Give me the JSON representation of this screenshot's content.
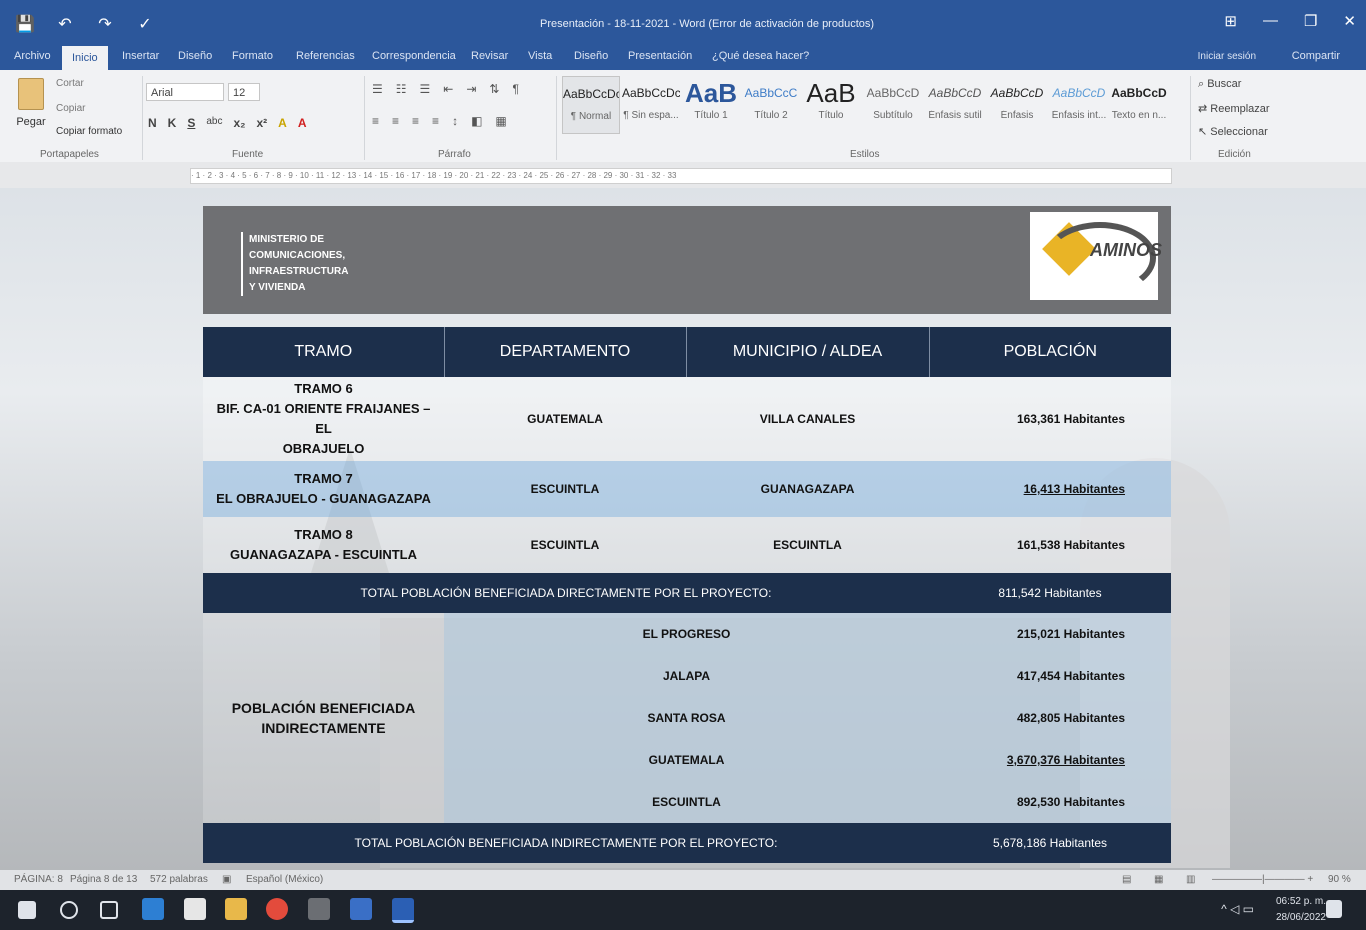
{
  "window": {
    "title": "Presentación - 18-11-2021 - Word (Error de activación de productos)",
    "controls": [
      "⊞",
      "—",
      "❐",
      "✕"
    ]
  },
  "quick_access": [
    "💾",
    "↶",
    "↷",
    "✓"
  ],
  "tabs": [
    "Archivo",
    "Inicio",
    "Insertar",
    "Diseño",
    "Formato",
    "Referencias",
    "Correspondencia",
    "Revisar",
    "Vista",
    "Diseño",
    "Presentación",
    "¿Qué desea hacer?"
  ],
  "account": {
    "signin": "Iniciar sesión",
    "share": "Compartir"
  },
  "ribbon": {
    "clipboard": {
      "paste": "Pegar",
      "cut": "Cortar",
      "copy": "Copiar",
      "format_painter": "Copiar formato",
      "label": "Portapapeles"
    },
    "font": {
      "name": "Arial",
      "size": "12",
      "label": "Fuente",
      "buttons": [
        "N",
        "K",
        "S",
        "abc",
        "x₂",
        "x²",
        "A",
        "A"
      ]
    },
    "paragraph": {
      "label": "Párrafo"
    },
    "styles": {
      "label": "Estilos",
      "items": [
        {
          "sample": "AaBbCcDc",
          "name": "¶ Normal"
        },
        {
          "sample": "AaBbCcDc",
          "name": "¶ Sin espa..."
        },
        {
          "sample": "AaB",
          "name": "Título 1"
        },
        {
          "sample": "AaBbCcC",
          "name": "Título 2"
        },
        {
          "sample": "AaB",
          "name": "Título"
        },
        {
          "sample": "AaBbCcD",
          "name": "Subtítulo"
        },
        {
          "sample": "AaBbCcD",
          "name": "Énfasis sutil"
        },
        {
          "sample": "AaBbCcD",
          "name": "Énfasis"
        },
        {
          "sample": "AaBbCcD",
          "name": "Énfasis int..."
        },
        {
          "sample": "AaBbCcD",
          "name": "Texto en n..."
        }
      ]
    },
    "editing": {
      "label": "Edición",
      "find": "Buscar",
      "replace": "Reemplazar",
      "select": "Seleccionar"
    }
  },
  "ruler": "· 1 · 2 · 3 · 4 · 5 · 6 · 7 · 8 · 9 · 10 · 11 · 12 · 13 · 14 · 15 · 16 · 17 · 18 · 19 · 20 · 21 · 22 · 23 · 24 · 25 · 26 · 27 · 28 · 29 · 30 · 31 · 32 · 33",
  "document": {
    "header": {
      "ministry_lines": [
        "MINISTERIO DE",
        "COMUNICACIONES,",
        "INFRAESTRUCTURA",
        "Y VIVIENDA"
      ],
      "logo_text": "AMINOS"
    },
    "table": {
      "headers": [
        "TRAMO",
        "DEPARTAMENTO",
        "MUNICIPIO / ALDEA",
        "POBLACIÓN"
      ],
      "rows": [
        {
          "tramo_lines": [
            "TRAMO 6",
            "BIF. CA-01 ORIENTE FRAIJANES – EL",
            "OBRAJUELO"
          ],
          "departamento": "GUATEMALA",
          "municipio": "VILLA CANALES",
          "poblacion": "163,361 Habitantes"
        },
        {
          "tramo_lines": [
            "TRAMO 7",
            "EL OBRAJUELO - GUANAGAZAPA"
          ],
          "departamento": "ESCUINTLA",
          "municipio": "GUANAGAZAPA",
          "poblacion": "16,413 Habitantes"
        },
        {
          "tramo_lines": [
            "TRAMO 8",
            "GUANAGAZAPA - ESCUINTLA"
          ],
          "departamento": "ESCUINTLA",
          "municipio": "ESCUINTLA",
          "poblacion": "161,538 Habitantes"
        }
      ],
      "total_direct": {
        "label": "TOTAL POBLACIÓN BENEFICIADA DIRECTAMENTE POR EL PROYECTO:",
        "value": "811,542 Habitantes"
      },
      "indirect": {
        "label_lines": [
          "POBLACIÓN BENEFICIADA",
          "INDIRECTAMENTE"
        ],
        "rows": [
          {
            "place": "EL PROGRESO",
            "poblacion": "215,021 Habitantes"
          },
          {
            "place": "JALAPA",
            "poblacion": "417,454 Habitantes"
          },
          {
            "place": "SANTA ROSA",
            "poblacion": "482,805 Habitantes"
          },
          {
            "place": "GUATEMALA",
            "poblacion": "3,670,376 Habitantes"
          },
          {
            "place": "ESCUINTLA",
            "poblacion": "892,530 Habitantes"
          }
        ]
      },
      "total_indirect": {
        "label": "TOTAL POBLACIÓN BENEFICIADA INDIRECTAMENTE POR EL PROYECTO:",
        "value": "5,678,186 Habitantes"
      }
    }
  },
  "statusbar": {
    "page_info": "PÁGINA: 8",
    "pages": "Página 8 de 13",
    "words": "572 palabras",
    "language": "Español (México)",
    "zoom": "90 %"
  },
  "taskbar": {
    "time": "06:52 p. m.",
    "date": "28/06/2022"
  },
  "colors": {
    "title_bar": "#2c579b",
    "table_header": "#1c2f4b",
    "doc_header": "#6f7073",
    "logo_accent": "#e9b426"
  }
}
